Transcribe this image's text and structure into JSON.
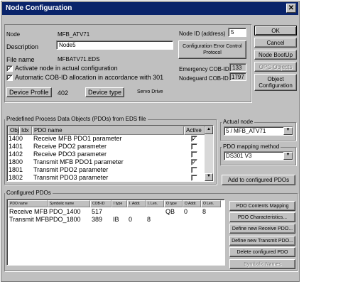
{
  "window": {
    "title": "Node Configuration"
  },
  "node": {
    "node_label": "Node",
    "node_value": "MFB_ATV71",
    "description_label": "Description",
    "description_value": "Node5",
    "file_name_label": "File name",
    "file_name_value": "MFBATV71.EDS",
    "activate_label": "Activate node in actual configuration",
    "activate_checked": true,
    "auto_cob_label": "Automatic COB-ID allocation in accordance with 301",
    "auto_cob_checked": true,
    "device_profile_label": "Device Profile",
    "device_profile_value": "402",
    "device_type_label": "Device type",
    "device_type_value": "Servo Drive",
    "node_id_label": "Node ID (address)",
    "node_id_value": "5",
    "config_error_label": "Configuration Error Control Protocol",
    "emergency_label": "Emergency COB-ID",
    "emergency_value": "133",
    "nodeguard_label": "Nodeguard COB-ID",
    "nodeguard_value": "1797"
  },
  "buttons": {
    "ok": "OK",
    "cancel": "Cancel",
    "node_bootup": "Node BootUp",
    "opc_objects": "OPC Objects",
    "object_configuration": "Object Configuration"
  },
  "predefined": {
    "title": "Predefined Process Data Objects (PDOs) from EDS file",
    "columns": [
      "Obj",
      "Idx",
      "PDO name",
      "Active"
    ],
    "rows": [
      {
        "obj": "1400",
        "name": "Receive MFB PDO1 parameter",
        "active": true
      },
      {
        "obj": "1401",
        "name": "Receive PDO2 parameter",
        "active": false
      },
      {
        "obj": "1402",
        "name": "Receive PDO3 parameter",
        "active": false
      },
      {
        "obj": "1800",
        "name": "Transmit MFB PDO1 parameter",
        "active": true
      },
      {
        "obj": "1801",
        "name": "Transmit PDO2 parameter",
        "active": false
      },
      {
        "obj": "1802",
        "name": "Transmit PDO3 parameter",
        "active": false
      }
    ]
  },
  "actual_node": {
    "title": "Actual node",
    "value": "5 / MFB_ATV71"
  },
  "pdo_mapping": {
    "title": "PDO mapping method",
    "value": "DS301 V3"
  },
  "add_configured_label": "Add to configured PDOs",
  "configured": {
    "title": "Configured PDOs",
    "columns": [
      "PDO name",
      "Symbolic name",
      "COB-ID",
      "I type",
      "I. Addr.",
      "I. Len.",
      "O type",
      "O Addr.",
      "O Len."
    ],
    "rows": [
      [
        "Receive MFB",
        "PDO_1400",
        "517",
        "",
        "",
        "",
        "QB",
        "0",
        "8"
      ],
      [
        "Transmit MFB",
        "PDO_1800",
        "389",
        "IB",
        "0",
        "8",
        "",
        "",
        ""
      ]
    ]
  },
  "configured_buttons": {
    "contents_mapping": "PDO Contents Mapping",
    "characteristics": "PDO Characteristics...",
    "new_receive": "Define new Receive PDO...",
    "new_transmit": "Define new Transmit PDO...",
    "delete": "Delete configured PDO",
    "symbolic": "Symbolic Names"
  }
}
